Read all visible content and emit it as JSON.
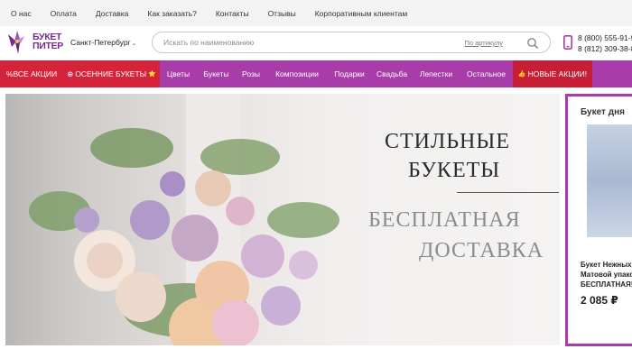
{
  "topnav": [
    "О нас",
    "Оплата",
    "Доставка",
    "Как заказать?",
    "Контакты",
    "Отзывы",
    "Корпоративным клиентам"
  ],
  "logo": {
    "line1": "БУКЕТ",
    "line2": "ПИТЕР"
  },
  "city": "Санкт-Петербург",
  "search": {
    "placeholder": "Искать по наименованию",
    "by_article": "По артикулу"
  },
  "phones": [
    "8 (800) 555-91-9",
    "8 (812) 309-38-8"
  ],
  "nav": [
    {
      "label": "ВСЕ АКЦИИ",
      "icon": "%",
      "style": "red"
    },
    {
      "label": "ОСЕННИЕ БУКЕТЫ",
      "icon": "⊕",
      "style": "red",
      "trail": "⭐"
    },
    {
      "label": "Цветы"
    },
    {
      "label": "Букеты"
    },
    {
      "label": "Розы"
    },
    {
      "label": "Композиции"
    },
    {
      "label": "Подарки"
    },
    {
      "label": "Свадьба"
    },
    {
      "label": "Лепестки"
    },
    {
      "label": "Остальное"
    },
    {
      "label": "НОВЫЕ АКЦИИ!",
      "icon": "👍",
      "style": "red2"
    }
  ],
  "banner": {
    "line1": "СТИЛЬНЫЕ",
    "line2": "БУКЕТЫ",
    "line3": "БЕСПЛАТНАЯ",
    "line4": "ДОСТАВКА"
  },
  "side": {
    "title": "Букет дня",
    "name_lines": [
      "Букет Нежных",
      "Матовой упако",
      "БЕСПЛАТНАЯ!"
    ],
    "price": "2 085 ₽"
  },
  "colors": {
    "purple": "#a83ca8",
    "red": "#d4233a",
    "logo": "#7a2a8f"
  },
  "icons": {
    "search": "search-icon",
    "phone": "phone-icon",
    "chevron": "chevron-down-icon"
  }
}
